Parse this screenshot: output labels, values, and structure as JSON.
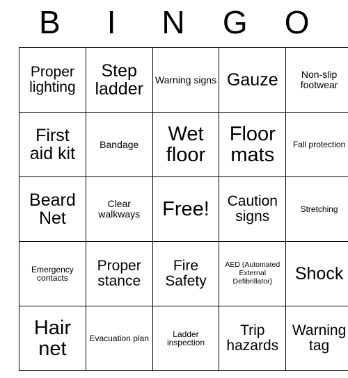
{
  "card": {
    "title": "BINGO",
    "headers": [
      "B",
      "I",
      "N",
      "G",
      "O"
    ],
    "free_space_label": "Free!",
    "rows": [
      [
        {
          "text": "Proper lighting",
          "size": "md"
        },
        {
          "text": "Step ladder",
          "size": "lg"
        },
        {
          "text": "Warning signs",
          "size": "sm"
        },
        {
          "text": "Gauze",
          "size": "lg"
        },
        {
          "text": "Non-slip footwear",
          "size": "sm"
        }
      ],
      [
        {
          "text": "First aid kit",
          "size": "lg"
        },
        {
          "text": "Bandage",
          "size": "sm"
        },
        {
          "text": "Wet floor",
          "size": "xl"
        },
        {
          "text": "Floor mats",
          "size": "xl"
        },
        {
          "text": "Fall protection",
          "size": "xs"
        }
      ],
      [
        {
          "text": "Beard Net",
          "size": "lg"
        },
        {
          "text": "Clear walkways",
          "size": "sm"
        },
        {
          "text": "Free!",
          "size": "xl"
        },
        {
          "text": "Caution signs",
          "size": "md"
        },
        {
          "text": "Stretching",
          "size": "xs"
        }
      ],
      [
        {
          "text": "Emergency contacts",
          "size": "xs"
        },
        {
          "text": "Proper stance",
          "size": "md"
        },
        {
          "text": "Fire Safety",
          "size": "md"
        },
        {
          "text": "AED (Automated External Defibrillator)",
          "size": "xxs"
        },
        {
          "text": "Shock",
          "size": "lg"
        }
      ],
      [
        {
          "text": "Hair net",
          "size": "xl"
        },
        {
          "text": "Evacuation plan",
          "size": "xs"
        },
        {
          "text": "Ladder inspection",
          "size": "xs"
        },
        {
          "text": "Trip hazards",
          "size": "md"
        },
        {
          "text": "Warning tag",
          "size": "md"
        }
      ]
    ]
  },
  "colors": {
    "background": "#ffffff",
    "text": "#000000",
    "grid_line": "#000000"
  }
}
